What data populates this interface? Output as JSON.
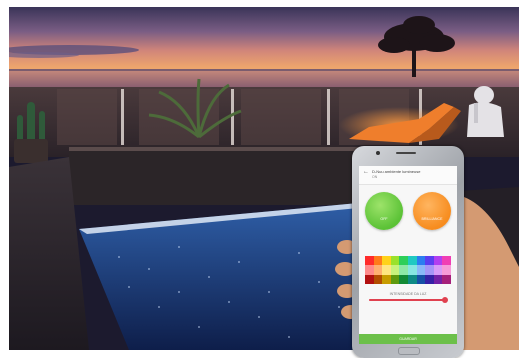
{
  "app": {
    "header_title": "D-Nuu ambiente lumineuse",
    "header_subtitle": "ON",
    "btn_left_label": "OFF",
    "btn_right_label": "BRILLIANCE",
    "slider_label": "INTENSIDADE DA LUZ",
    "slider_level": 0.97,
    "bottom_label": "GUARDAR"
  },
  "colors": {
    "btn_green": "#5bc236",
    "btn_orange": "#f78c1e",
    "slider_accent": "#e0414f",
    "bottom_bar": "#6cc04a"
  },
  "palette": [
    [
      "#ff2b2b",
      "#ff8a8a",
      "#b21010"
    ],
    [
      "#ff7a1a",
      "#ffb070",
      "#b34d00"
    ],
    [
      "#ffd21a",
      "#ffe680",
      "#c79c00"
    ],
    [
      "#9be12c",
      "#c8f27c",
      "#5f9a0e"
    ],
    [
      "#2ecf5a",
      "#8ee8a6",
      "#138a35"
    ],
    [
      "#20c9c2",
      "#86e6e2",
      "#0e8a85"
    ],
    [
      "#2c7df0",
      "#8ab8f8",
      "#1650a6"
    ],
    [
      "#5a3ff0",
      "#a595f7",
      "#3620a6"
    ],
    [
      "#b13ff0",
      "#d89bf8",
      "#7320a6"
    ],
    [
      "#f03fb4",
      "#f79bd8",
      "#a6207a"
    ]
  ]
}
